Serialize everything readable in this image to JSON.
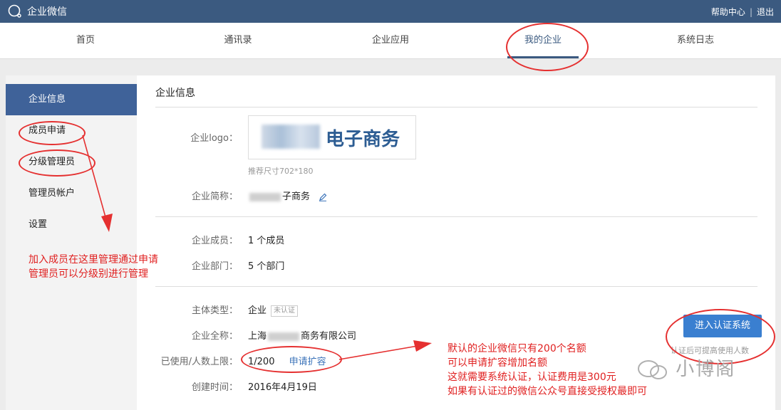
{
  "app": {
    "name": "企业微信"
  },
  "toplinks": {
    "help": "帮助中心",
    "logout": "退出",
    "sep": "|"
  },
  "nav": [
    "首页",
    "通讯录",
    "企业应用",
    "我的企业",
    "系统日志"
  ],
  "sidebar": [
    "企业信息",
    "成员申请",
    "分级管理员",
    "管理员帐户",
    "设置"
  ],
  "main": {
    "title": "企业信息",
    "logo_label": "企业logo：",
    "logo_text": "电子商务",
    "logo_hint": "推荐尺寸702*180",
    "short_name_label": "企业简称：",
    "short_name_value": "子商务",
    "members_label": "企业成员：",
    "members_value": "1 个成员",
    "departments_label": "企业部门：",
    "departments_value": "5 个部门",
    "entity_type_label": "主体类型：",
    "entity_type_value": "企业",
    "unverified_tag": "未认证",
    "fullname_label": "企业全称：",
    "fullname_prefix": "上海",
    "fullname_suffix": "商务有限公司",
    "usage_label": "已使用/人数上限：",
    "usage_value": "1/200",
    "expand_link": "申请扩容",
    "created_label": "创建时间：",
    "created_value": "2016年4月19日",
    "verify_button": "进入认证系统",
    "verify_hint": "认证后可提高使用人数"
  },
  "annotations": {
    "left_line1": "加入成员在这里管理通过申请",
    "left_line2": "管理员可以分级别进行管理",
    "right_line1": "默认的企业微信只有200个名额",
    "right_line2": "可以申请扩容增加名额",
    "right_line3": "这就需要系统认证，认证费用是300元",
    "right_line4": "如果有认证过的微信公众号直接受授权最即可"
  },
  "watermark": "小博阁",
  "colors": {
    "topbar": "#3b5a80",
    "active_side": "#3f6299",
    "button": "#3a7fd0",
    "annotation": "#e02020"
  }
}
